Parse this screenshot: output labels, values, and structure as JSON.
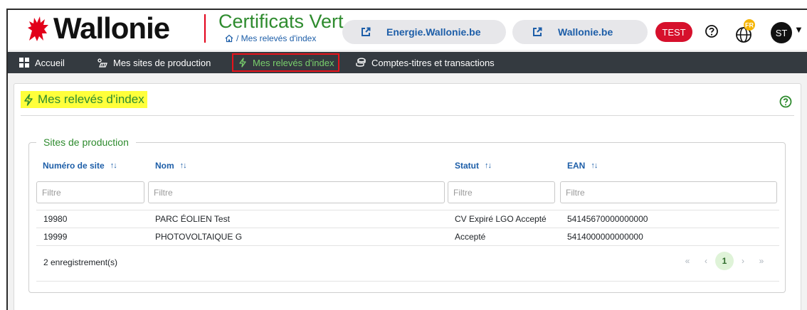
{
  "header": {
    "logo_text": "Wallonie",
    "app_title": "Certificats Vert",
    "breadcrumb": "/ Mes relevés d'index",
    "links": [
      {
        "label": "Energie.Wallonie.be"
      },
      {
        "label": "Wallonie.be"
      }
    ],
    "env_badge": "TEST",
    "lang_badge": "FR",
    "avatar_initials": "ST"
  },
  "nav": {
    "items": [
      {
        "label": "Accueil",
        "icon": "grid-icon"
      },
      {
        "label": "Mes sites de production",
        "icon": "solar-panel-icon"
      },
      {
        "label": "Mes relevés d'index",
        "icon": "lightning-icon",
        "active": true
      },
      {
        "label": "Comptes-titres et transactions",
        "icon": "coins-icon"
      }
    ]
  },
  "page": {
    "title": "Mes relevés d'index",
    "section_legend": "Sites de production",
    "columns": [
      {
        "label": "Numéro de site",
        "filter_placeholder": "Filtre"
      },
      {
        "label": "Nom",
        "filter_placeholder": "Filtre"
      },
      {
        "label": "Statut",
        "filter_placeholder": "Filtre"
      },
      {
        "label": "EAN",
        "filter_placeholder": "Filtre"
      }
    ],
    "rows": [
      {
        "site": "19980",
        "nom": "PARC ÉOLIEN Test",
        "statut": "CV Expiré LGO Accepté",
        "ean": "54145670000000000"
      },
      {
        "site": "19999",
        "nom": "PHOTOVOLTAIQUE G",
        "statut": "Accepté",
        "ean": "5414000000000000"
      }
    ],
    "record_count": "2 enregistrement(s)",
    "pagination": {
      "current_page": "1",
      "first": "«",
      "prev": "‹",
      "next": "›",
      "last": "»"
    }
  },
  "colors": {
    "brand_red": "#e2001a",
    "title_green": "#2e8b2e",
    "link_blue": "#1d5ea8",
    "nav_bg": "#343a40",
    "highlight_yellow": "#ffff3b"
  }
}
